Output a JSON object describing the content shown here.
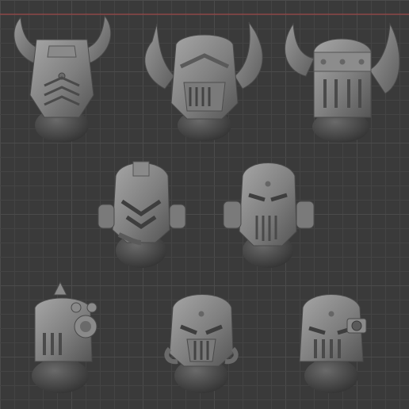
{
  "scene": {
    "background": "#3a3a3a",
    "grid_minor": "#444444",
    "grid_major": "#4b4b4b",
    "axis_line_color": "#b04848",
    "model_light": "#9c9c9c",
    "model_mid": "#7e7e7e",
    "model_dark": "#5a5a5a",
    "model_shadow": "#3c3c3c",
    "models": [
      {
        "name": "helmet-horned-ribbed"
      },
      {
        "name": "helmet-horned-grille"
      },
      {
        "name": "helmet-horned-studded"
      },
      {
        "name": "helmet-chevron-mask"
      },
      {
        "name": "helmet-crest-mask"
      },
      {
        "name": "helmet-spiked-ornament"
      },
      {
        "name": "helmet-caged-faceplate"
      },
      {
        "name": "helmet-side-lens"
      }
    ]
  }
}
